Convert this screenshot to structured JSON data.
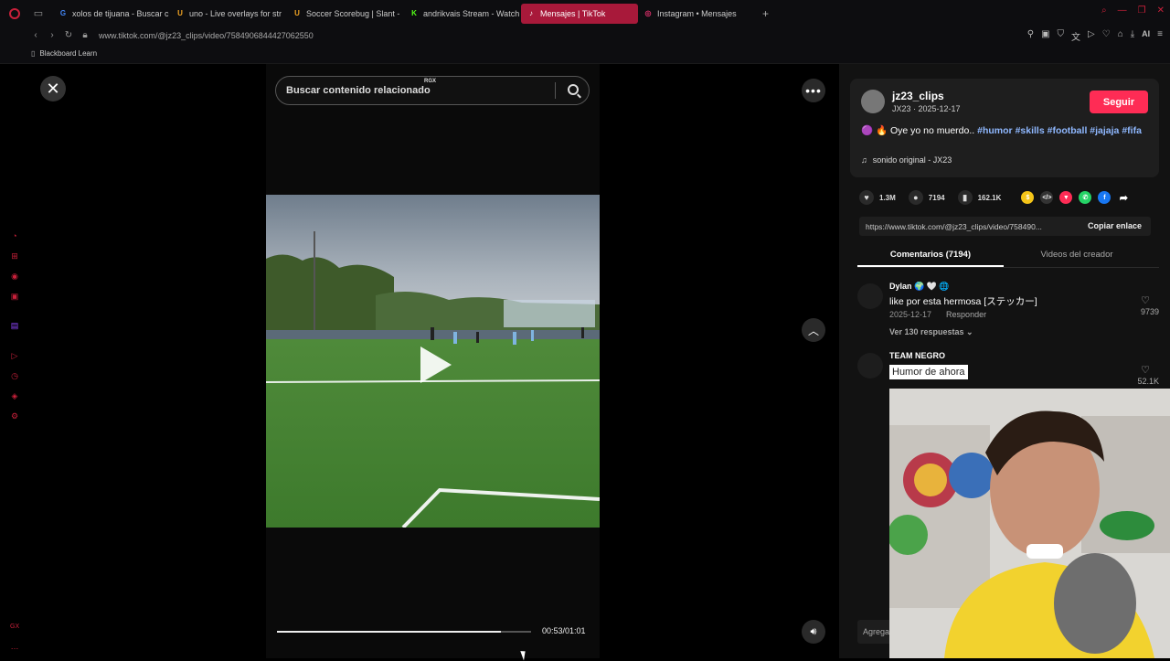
{
  "browser": {
    "tabs": [
      {
        "label": "xolos de tijuana - Buscar c",
        "icon": "google-icon",
        "color": "#4285f4",
        "glyph": "G"
      },
      {
        "label": "uno - Live overlays for str",
        "icon": "uno-icon",
        "color": "#f5a623",
        "glyph": "U"
      },
      {
        "label": "Soccer Scorebug | Slant -",
        "icon": "slant-icon",
        "color": "#f5a623",
        "glyph": "U"
      },
      {
        "label": "andrikvais Stream - Watch",
        "icon": "kick-icon",
        "color": "#53fc18",
        "glyph": "K"
      },
      {
        "label": "Mensajes | TikTok",
        "icon": "tiktok-icon",
        "color": "#ffffff",
        "glyph": "♪",
        "active": true
      },
      {
        "label": "Instagram • Mensajes",
        "icon": "instagram-icon",
        "color": "#e1306c",
        "glyph": "◎"
      }
    ],
    "url": "www.tiktok.com/@jz23_clips/video/7584906844427062550",
    "bookmark": "Blackboard Learn",
    "extension_label": "AI"
  },
  "video": {
    "search_placeholder": "Buscar contenido relacionado",
    "rgx_label": "RGX",
    "time": "00:53/01:01",
    "progress": 0.88
  },
  "post": {
    "username": "jz23_clips",
    "subline": "JX23 · 2025-12-17",
    "follow_label": "Seguir",
    "desc_text": "🟣 🔥 Oye yo no muerdo.. ",
    "tags": [
      "#humor",
      "#skills",
      "#football",
      "#jajaja",
      "#fifa"
    ],
    "sound": "sonido original - JX23",
    "likes": "1.3M",
    "comments": "7194",
    "saves": "162.1K",
    "link": "https://www.tiktok.com/@jz23_clips/video/758490...",
    "copy_label": "Copiar enlace"
  },
  "tabs": {
    "comments": "Comentarios (7194)",
    "creator": "Videos del creador"
  },
  "comments": [
    {
      "name": "Dylan 🌍 🤍 🌐",
      "text": "like por esta hermosa [ステッカー]",
      "date": "2025-12-17",
      "reply": "Responder",
      "replies": "Ver 130 respuestas ⌄",
      "likes": "9739"
    },
    {
      "name": "TEAM NEGRO",
      "sticker": "Humor de ahora",
      "likes": "52.1K"
    }
  ],
  "add_comment_placeholder": "Agregar c"
}
